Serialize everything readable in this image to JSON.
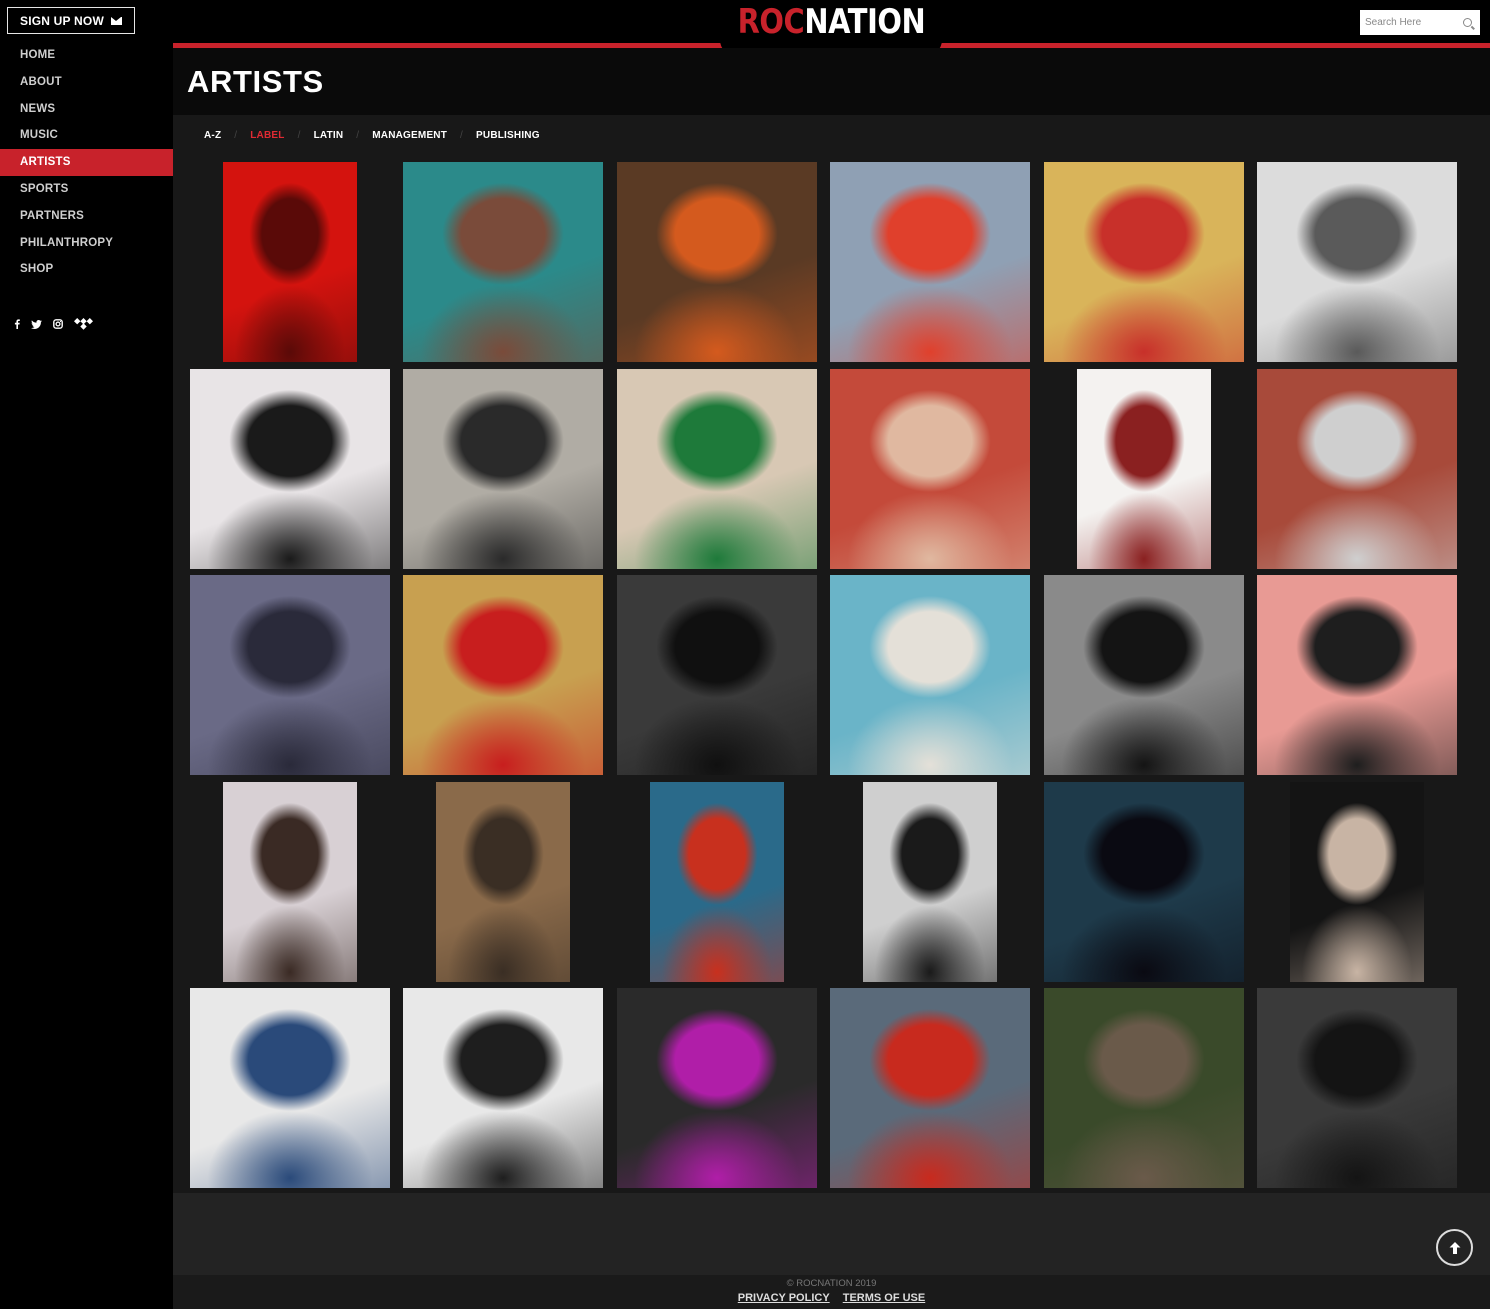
{
  "sidebar": {
    "signup_label": "SIGN UP NOW",
    "nav": [
      "HOME",
      "ABOUT",
      "NEWS",
      "MUSIC",
      "ARTISTS",
      "SPORTS",
      "PARTNERS",
      "PHILANTHROPY",
      "SHOP"
    ],
    "active_nav": "ARTISTS",
    "social": [
      "facebook-icon",
      "twitter-icon",
      "instagram-icon",
      "tidal-icon"
    ]
  },
  "header": {
    "logo_part1": "ROC",
    "logo_part2": "NATION",
    "search_placeholder": "Search Here"
  },
  "page": {
    "title": "ARTISTS"
  },
  "filters": {
    "items": [
      "A-Z",
      "LABEL",
      "LATIN",
      "MANAGEMENT",
      "PUBLISHING"
    ],
    "active": "LABEL"
  },
  "artists": [
    {
      "row": 0,
      "col": 0,
      "portrait": true,
      "palette": [
        "#d4130e",
        "#5a0a08"
      ]
    },
    {
      "row": 0,
      "col": 1,
      "portrait": false,
      "palette": [
        "#2b8a8a",
        "#7a4b3a"
      ]
    },
    {
      "row": 0,
      "col": 2,
      "portrait": false,
      "palette": [
        "#5a3a24",
        "#d45a1e"
      ]
    },
    {
      "row": 0,
      "col": 3,
      "portrait": false,
      "palette": [
        "#8fa0b4",
        "#e0402c"
      ]
    },
    {
      "row": 0,
      "col": 4,
      "portrait": false,
      "palette": [
        "#d9b45a",
        "#c8302a"
      ]
    },
    {
      "row": 0,
      "col": 5,
      "portrait": false,
      "palette": [
        "#dcdcdc",
        "#5a5a5a"
      ]
    },
    {
      "row": 1,
      "col": 0,
      "portrait": false,
      "palette": [
        "#e8e4e6",
        "#1a1a1a"
      ]
    },
    {
      "row": 1,
      "col": 1,
      "portrait": false,
      "palette": [
        "#b0aca4",
        "#2a2a2a"
      ]
    },
    {
      "row": 1,
      "col": 2,
      "portrait": false,
      "palette": [
        "#d8c8b4",
        "#1e7a3a"
      ]
    },
    {
      "row": 1,
      "col": 3,
      "portrait": false,
      "palette": [
        "#c44a3a",
        "#e0b8a0"
      ]
    },
    {
      "row": 1,
      "col": 4,
      "portrait": true,
      "palette": [
        "#f4f2f0",
        "#8a2020"
      ]
    },
    {
      "row": 1,
      "col": 5,
      "portrait": false,
      "palette": [
        "#a84a3a",
        "#cfcfcf"
      ]
    },
    {
      "row": 2,
      "col": 0,
      "portrait": false,
      "palette": [
        "#6a6a86",
        "#2a2a3a"
      ]
    },
    {
      "row": 2,
      "col": 1,
      "portrait": false,
      "palette": [
        "#c8a050",
        "#c81e1e"
      ]
    },
    {
      "row": 2,
      "col": 2,
      "portrait": false,
      "palette": [
        "#3a3a3a",
        "#101010"
      ]
    },
    {
      "row": 2,
      "col": 3,
      "portrait": false,
      "palette": [
        "#6ab4c8",
        "#e4e0d8"
      ]
    },
    {
      "row": 2,
      "col": 4,
      "portrait": false,
      "palette": [
        "#8a8a8a",
        "#141414"
      ]
    },
    {
      "row": 2,
      "col": 5,
      "portrait": false,
      "palette": [
        "#e89a94",
        "#1e1e1e"
      ]
    },
    {
      "row": 3,
      "col": 0,
      "portrait": true,
      "palette": [
        "#d8d0d4",
        "#3a2a24"
      ]
    },
    {
      "row": 3,
      "col": 1,
      "portrait": true,
      "palette": [
        "#8a6a4a",
        "#3a2e24"
      ]
    },
    {
      "row": 3,
      "col": 2,
      "portrait": true,
      "palette": [
        "#2a6a8a",
        "#c8301e"
      ]
    },
    {
      "row": 3,
      "col": 3,
      "portrait": true,
      "palette": [
        "#cfcfcf",
        "#1a1a1a"
      ]
    },
    {
      "row": 3,
      "col": 4,
      "portrait": false,
      "palette": [
        "#1e3a4a",
        "#0a0a12"
      ]
    },
    {
      "row": 3,
      "col": 5,
      "portrait": true,
      "palette": [
        "#141414",
        "#c8b4a4"
      ]
    },
    {
      "row": 4,
      "col": 0,
      "portrait": false,
      "palette": [
        "#e8e8e8",
        "#2a4a7a"
      ]
    },
    {
      "row": 4,
      "col": 1,
      "portrait": false,
      "palette": [
        "#e8e8e8",
        "#1e1e1e"
      ]
    },
    {
      "row": 4,
      "col": 2,
      "portrait": false,
      "palette": [
        "#2a2a2a",
        "#b01ea8"
      ]
    },
    {
      "row": 4,
      "col": 3,
      "portrait": false,
      "palette": [
        "#5a6a7a",
        "#c82a1e"
      ]
    },
    {
      "row": 4,
      "col": 4,
      "portrait": false,
      "palette": [
        "#3a4a2a",
        "#6a5a4a"
      ]
    },
    {
      "row": 4,
      "col": 5,
      "portrait": false,
      "palette": [
        "#3a3a3a",
        "#141414"
      ]
    }
  ],
  "footer": {
    "copyright": "© ROCNATION 2019",
    "privacy": "PRIVACY POLICY",
    "terms": "TERMS OF USE"
  }
}
